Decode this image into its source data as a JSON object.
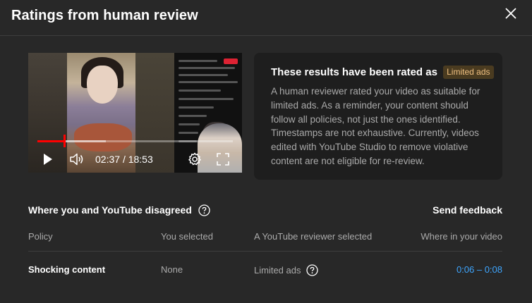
{
  "dialog": {
    "title": "Ratings from human review",
    "close_icon": "close-icon"
  },
  "player": {
    "current_time": "02:37",
    "separator": "/",
    "duration": "18:53",
    "progress": 0.139,
    "buffered": 0.35,
    "icons": [
      "play-icon",
      "volume-icon",
      "settings-gear-icon",
      "fullscreen-icon"
    ]
  },
  "info_card": {
    "heading": "These results have been rated as",
    "badge": "Limited ads",
    "body": "A human reviewer rated your video as suitable for limited ads. As a reminder, your content should follow all policies, not just the ones identified. Timestamps are not exhaustive. Currently, videos edited with YouTube Studio to remove violative content are not eligible for re-review."
  },
  "disagreement": {
    "title": "Where you and YouTube disagreed",
    "feedback_label": "Send feedback",
    "columns": [
      "Policy",
      "You selected",
      "A YouTube reviewer selected",
      "Where in your video"
    ],
    "rows": [
      {
        "policy": "Shocking content",
        "you_selected": "None",
        "reviewer_selected": "Limited ads",
        "timestamp": "0:06 – 0:08"
      }
    ]
  },
  "colors": {
    "background": "#282828",
    "card": "#1e1e1e",
    "secondary_text": "#aaaaaa",
    "link": "#3ea6ff",
    "badge_text": "#f0c080",
    "badge_bg": "#4a3b20",
    "progress": "#ff0000"
  }
}
